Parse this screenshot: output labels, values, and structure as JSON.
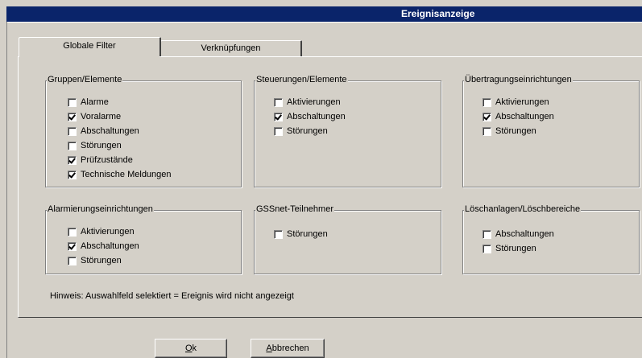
{
  "window": {
    "title": "Ereignisanzeige"
  },
  "tabs": [
    {
      "label": "Globale Filter",
      "active": true
    },
    {
      "label": "Verknüpfungen",
      "active": false
    }
  ],
  "groups": {
    "gruppen": {
      "title": "Gruppen/Elemente",
      "items": [
        {
          "label": "Alarme",
          "checked": false
        },
        {
          "label": "Voralarme",
          "checked": true
        },
        {
          "label": "Abschaltungen",
          "checked": false
        },
        {
          "label": "Störungen",
          "checked": false
        },
        {
          "label": "Prüfzustände",
          "checked": true
        },
        {
          "label": "Technische Meldungen",
          "checked": true
        }
      ]
    },
    "steuerungen": {
      "title": "Steuerungen/Elemente",
      "items": [
        {
          "label": "Aktivierungen",
          "checked": false
        },
        {
          "label": "Abschaltungen",
          "checked": true
        },
        {
          "label": "Störungen",
          "checked": false
        }
      ]
    },
    "uebertragung": {
      "title": "Übertragungseinrichtungen",
      "items": [
        {
          "label": "Aktivierungen",
          "checked": false
        },
        {
          "label": "Abschaltungen",
          "checked": true
        },
        {
          "label": "Störungen",
          "checked": false
        }
      ]
    },
    "alarmierung": {
      "title": "Alarmierungseinrichtungen",
      "items": [
        {
          "label": "Aktivierungen",
          "checked": false
        },
        {
          "label": "Abschaltungen",
          "checked": true
        },
        {
          "label": "Störungen",
          "checked": false
        }
      ]
    },
    "gssnet": {
      "title": "GSSnet-Teilnehmer",
      "items": [
        {
          "label": "Störungen",
          "checked": false
        }
      ]
    },
    "loeschanlagen": {
      "title": "Löschanlagen/Löschbereiche",
      "items": [
        {
          "label": "Abschaltungen",
          "checked": false
        },
        {
          "label": "Störungen",
          "checked": false
        }
      ]
    }
  },
  "hint": "Hinweis: Auswahlfeld selektiert = Ereignis wird nicht angezeigt",
  "buttons": {
    "ok_mnemonic": "O",
    "ok_rest": "k",
    "cancel_mnemonic": "A",
    "cancel_rest": "bbrechen"
  }
}
